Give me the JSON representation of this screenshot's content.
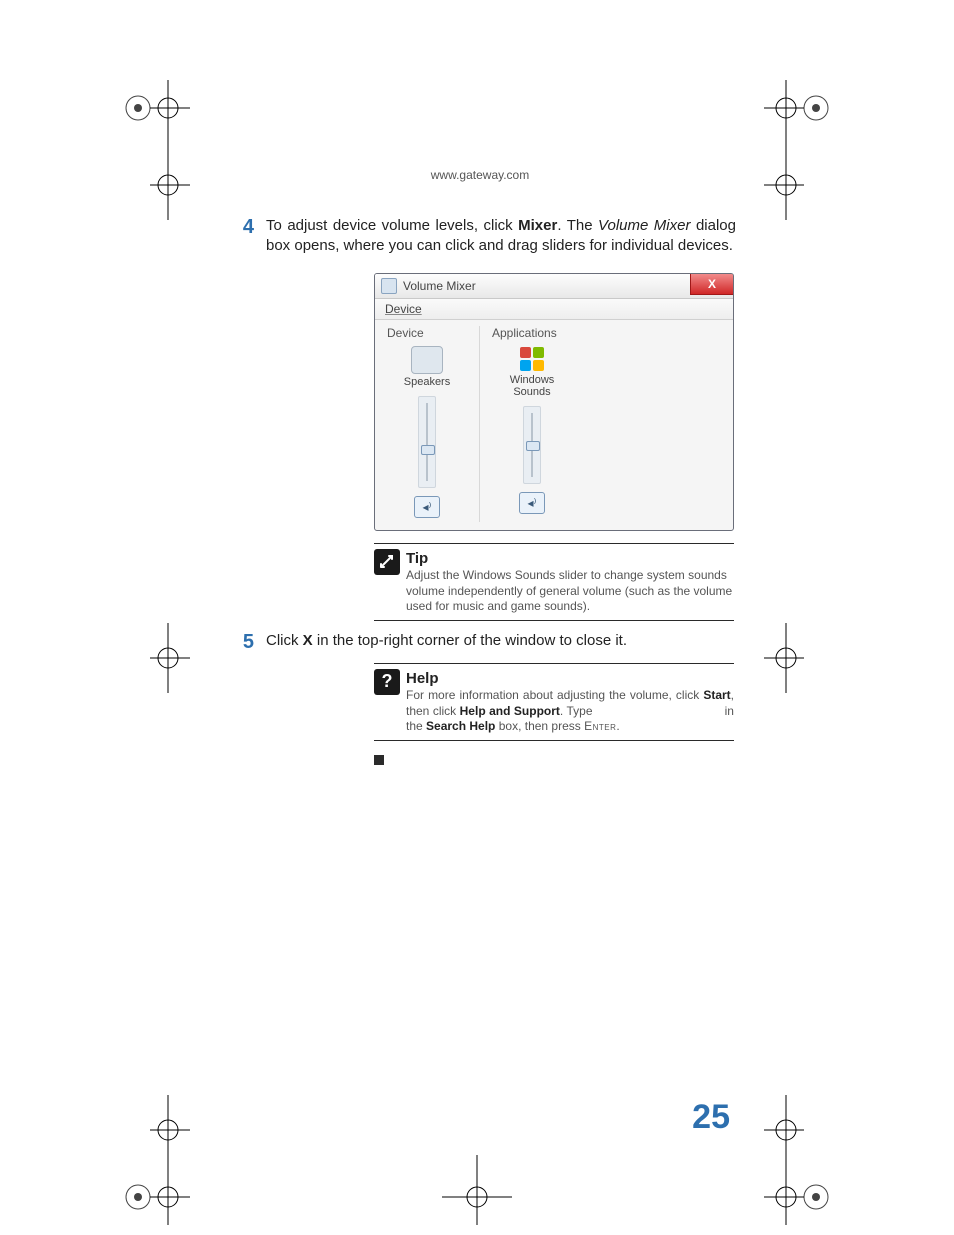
{
  "header": {
    "url": "www.gateway.com"
  },
  "steps": {
    "s4": {
      "num": "4",
      "text_pre": "To adjust device volume levels, click ",
      "bold1": "Mixer",
      "text_mid": ". The ",
      "ital": "Volume Mixer",
      "text_post": " dialog box opens, where you can click and drag sliders for individual devices."
    },
    "s5": {
      "num": "5",
      "text_pre": "Click ",
      "bold1": "X",
      "text_post": " in the top-right corner of the window to close it."
    }
  },
  "screenshot": {
    "title": "Volume Mixer",
    "close_x": "X",
    "menu_device": "Device",
    "section_device": "Device",
    "section_apps": "Applications",
    "col1_label": "Speakers",
    "col2_label_a": "Windows",
    "col2_label_b": "Sounds",
    "mute_glyph": "◂⁾"
  },
  "tip": {
    "title": "Tip",
    "body": "Adjust the Windows Sounds slider to change system sounds volume independently of general volume (such as the volume used for music and game sounds)."
  },
  "help": {
    "title": "Help",
    "p1": "For more information about adjusting the volume, click ",
    "b1": "Start",
    "p2": ", then click ",
    "b2": "Help and Support",
    "p3": ". Type ",
    "gap": "                                    ",
    "p4": " in the ",
    "b3": "Search Help",
    "p5": " box, then press ",
    "sc": "Enter",
    "p6": "."
  },
  "page_number": "25"
}
